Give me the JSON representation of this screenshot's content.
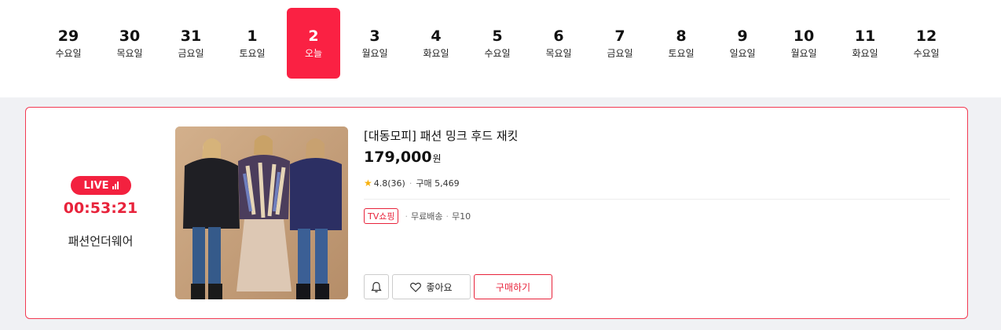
{
  "dates": [
    {
      "num": "29",
      "label": "수요일",
      "active": false
    },
    {
      "num": "30",
      "label": "목요일",
      "active": false
    },
    {
      "num": "31",
      "label": "금요일",
      "active": false
    },
    {
      "num": "1",
      "label": "토요일",
      "active": false
    },
    {
      "num": "2",
      "label": "오늘",
      "active": true
    },
    {
      "num": "3",
      "label": "월요일",
      "active": false
    },
    {
      "num": "4",
      "label": "화요일",
      "active": false
    },
    {
      "num": "5",
      "label": "수요일",
      "active": false
    },
    {
      "num": "6",
      "label": "목요일",
      "active": false
    },
    {
      "num": "7",
      "label": "금요일",
      "active": false
    },
    {
      "num": "8",
      "label": "토요일",
      "active": false
    },
    {
      "num": "9",
      "label": "일요일",
      "active": false
    },
    {
      "num": "10",
      "label": "월요일",
      "active": false
    },
    {
      "num": "11",
      "label": "화요일",
      "active": false
    },
    {
      "num": "12",
      "label": "수요일",
      "active": false
    }
  ],
  "live": {
    "badge": "LIVE",
    "timer": "00:53:21",
    "category": "패션언더웨어"
  },
  "product": {
    "title": "[대동모피] 패션 밍크 후드 재킷",
    "price": "179,000",
    "currency": "원",
    "rating": "4.8(36)",
    "purchases": "구매 5,469",
    "tv_tag": "TV쇼핑",
    "shipping": "무료배송",
    "installment": "무10"
  },
  "actions": {
    "like": "좋아요",
    "buy": "구매하기"
  },
  "colors": {
    "accent": "#fa2143",
    "live_badge": "#f3213f",
    "timer": "#e8233b",
    "star": "#f8b10c"
  },
  "icons": [
    "bell-icon",
    "heart-icon",
    "star-icon",
    "signal-icon"
  ]
}
